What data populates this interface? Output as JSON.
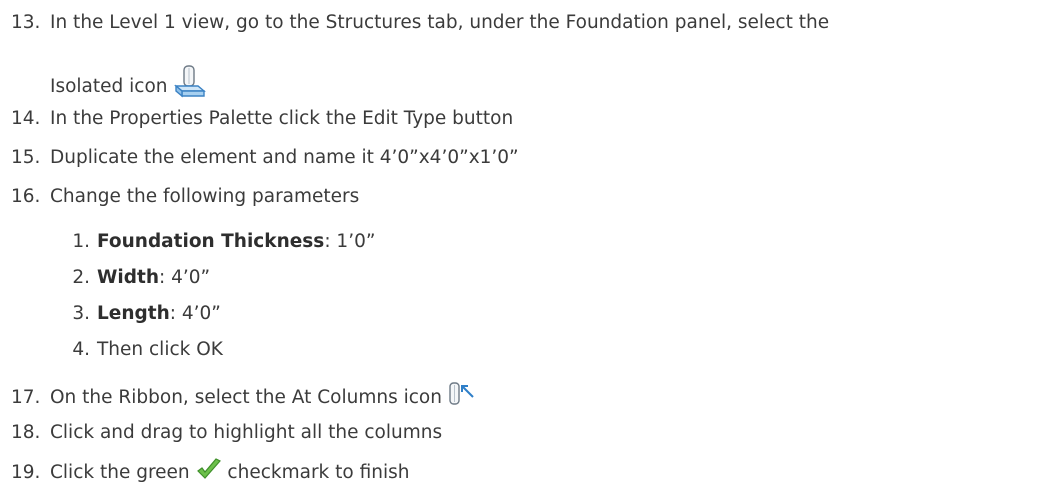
{
  "steps": [
    {
      "num": "13.",
      "text": "In the Level 1 view, go to the Structures tab, under the Foundation panel, select the",
      "cont": "Isolated icon",
      "icon": "isolated-foundation-icon"
    },
    {
      "num": "14.",
      "text": "In the Properties Palette click the Edit Type button"
    },
    {
      "num": "15.",
      "text": "Duplicate the element and name it 4’0”x4’0”x1’0”"
    },
    {
      "num": "16.",
      "text": "Change the following parameters"
    },
    {
      "num": "17.",
      "text": "On the Ribbon, select the At Columns icon",
      "icon": "at-columns-icon"
    },
    {
      "num": "18.",
      "text": "Click and drag to highlight all the columns"
    },
    {
      "num": "19.",
      "text_before": "Click the green",
      "text_after": "checkmark to finish",
      "icon": "green-checkmark-icon"
    }
  ],
  "substeps": [
    {
      "num": "1.",
      "label": "Foundation Thickness",
      "value": ": 1’0”"
    },
    {
      "num": "2.",
      "label": "Width",
      "value": ": 4’0”"
    },
    {
      "num": "3.",
      "label": "Length",
      "value": ": 4’0”"
    },
    {
      "num": "4.",
      "text": "Then click OK"
    }
  ],
  "colors": {
    "text": "#3b3b3b",
    "check_green": "#6cc04a"
  }
}
